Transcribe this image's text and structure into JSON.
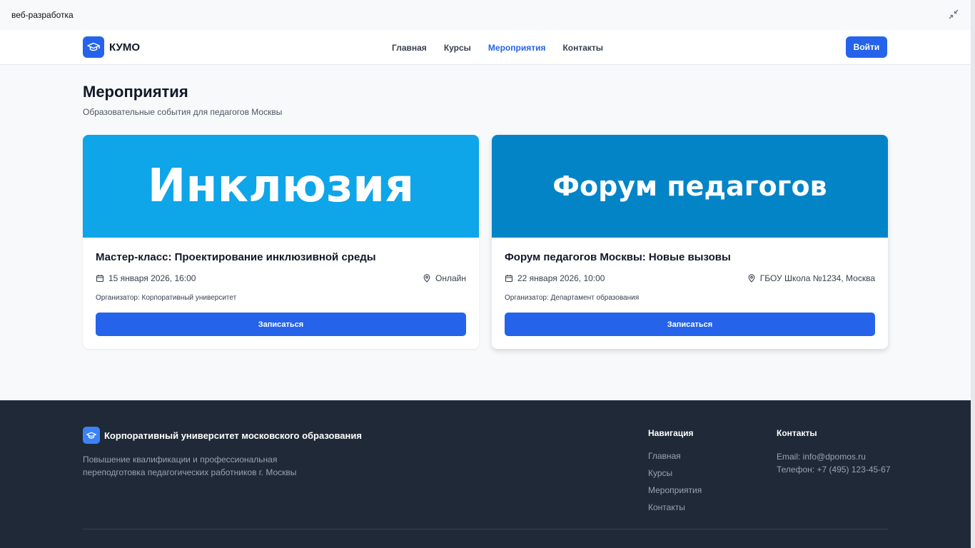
{
  "window": {
    "title": "веб-разработка"
  },
  "header": {
    "logo_text": "КУМО",
    "nav": [
      {
        "label": "Главная",
        "active": false
      },
      {
        "label": "Курсы",
        "active": false
      },
      {
        "label": "Мероприятия",
        "active": true
      },
      {
        "label": "Контакты",
        "active": false
      }
    ],
    "login_label": "Войти"
  },
  "page": {
    "title": "Мероприятия",
    "subtitle": "Образовательные события для педагогов Москвы"
  },
  "events": [
    {
      "banner_text": "Инклюзия",
      "banner_color": "#0ea5e9",
      "title": "Мастер-класс: Проектирование инклюзивной среды",
      "date": "15 января 2026, 16:00",
      "location": "Онлайн",
      "organizer": "Организатор: Корпоративный университет",
      "button_label": "Записаться"
    },
    {
      "banner_text": "Форум педагогов",
      "banner_color": "#0284c7",
      "title": "Форум педагогов Москвы: Новые вызовы",
      "date": "22 января 2026, 10:00",
      "location": "ГБОУ Школа №1234, Москва",
      "organizer": "Организатор: Департамент образования",
      "button_label": "Записаться"
    }
  ],
  "footer": {
    "brand": "Корпоративный университет московского образования",
    "description": "Повышение квалификации и профессиональная переподготовка педагогических работников г. Москвы",
    "nav_heading": "Навигация",
    "nav_links": [
      "Главная",
      "Курсы",
      "Мероприятия",
      "Контакты"
    ],
    "contacts_heading": "Контакты",
    "email": "Email: info@dpomos.ru",
    "phone": "Телефон: +7 (495) 123-45-67"
  },
  "colors": {
    "accent": "#2563eb",
    "footer_bg": "#1f2937"
  },
  "icons": {
    "logo": "graduation-cap-icon",
    "date": "calendar-icon",
    "location": "map-pin-icon",
    "window": "collapse-icon"
  }
}
